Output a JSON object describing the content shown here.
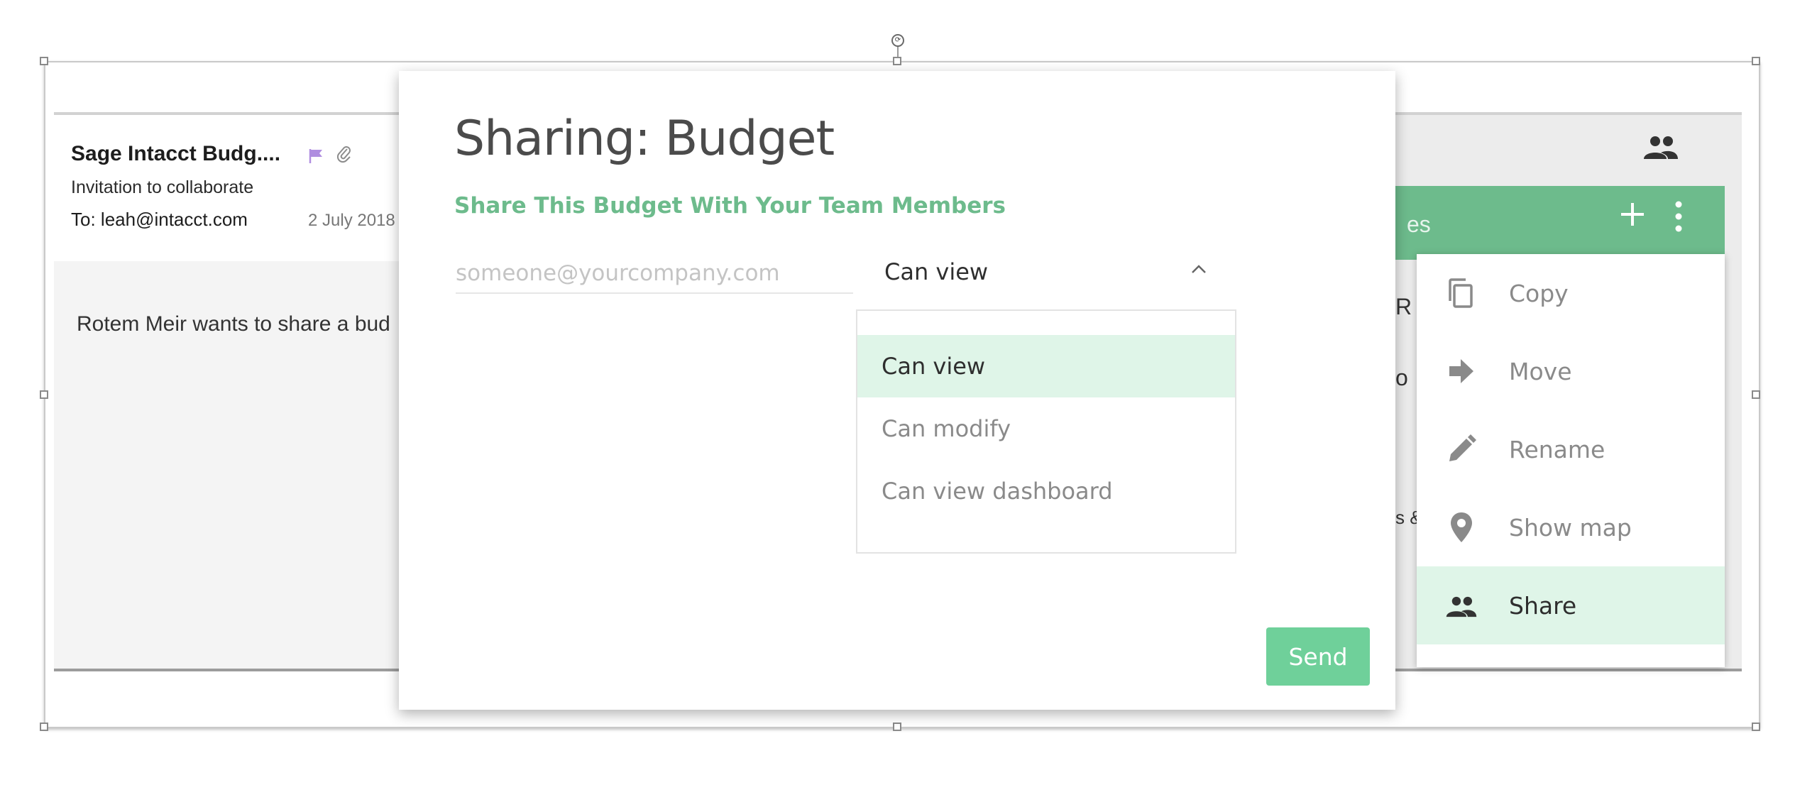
{
  "email": {
    "from": "Sage Intacct Budg....",
    "subject": "Invitation to collaborate",
    "to_label": "To:",
    "to_address": "leah@intacct.com",
    "date": "2 July 2018",
    "body_text": "Rotem Meir wants to share a bud",
    "flag_color": "#b08ee0"
  },
  "background_panel": {
    "green_bar_text": "es",
    "peek_texts": [
      "R",
      "o",
      "s &"
    ],
    "accent_color": "#6dbb8c"
  },
  "context_menu": {
    "items": [
      {
        "label": "Copy",
        "icon": "copy-icon",
        "active": false
      },
      {
        "label": "Move",
        "icon": "arrow-right-icon",
        "active": false
      },
      {
        "label": "Rename",
        "icon": "pencil-icon",
        "active": false
      },
      {
        "label": "Show map",
        "icon": "map-pin-icon",
        "active": false
      },
      {
        "label": "Share",
        "icon": "people-icon",
        "active": true
      }
    ],
    "active_color": "#dff5e8"
  },
  "modal": {
    "title": "Sharing: Budget",
    "subtitle": "Share This Budget With Your Team Members",
    "email_placeholder": "someone@yourcompany.com",
    "permission_selected": "Can view",
    "permission_options": [
      "Can view",
      "Can modify",
      "Can view dashboard"
    ],
    "send_label": "Send",
    "send_color": "#6fd09a"
  }
}
